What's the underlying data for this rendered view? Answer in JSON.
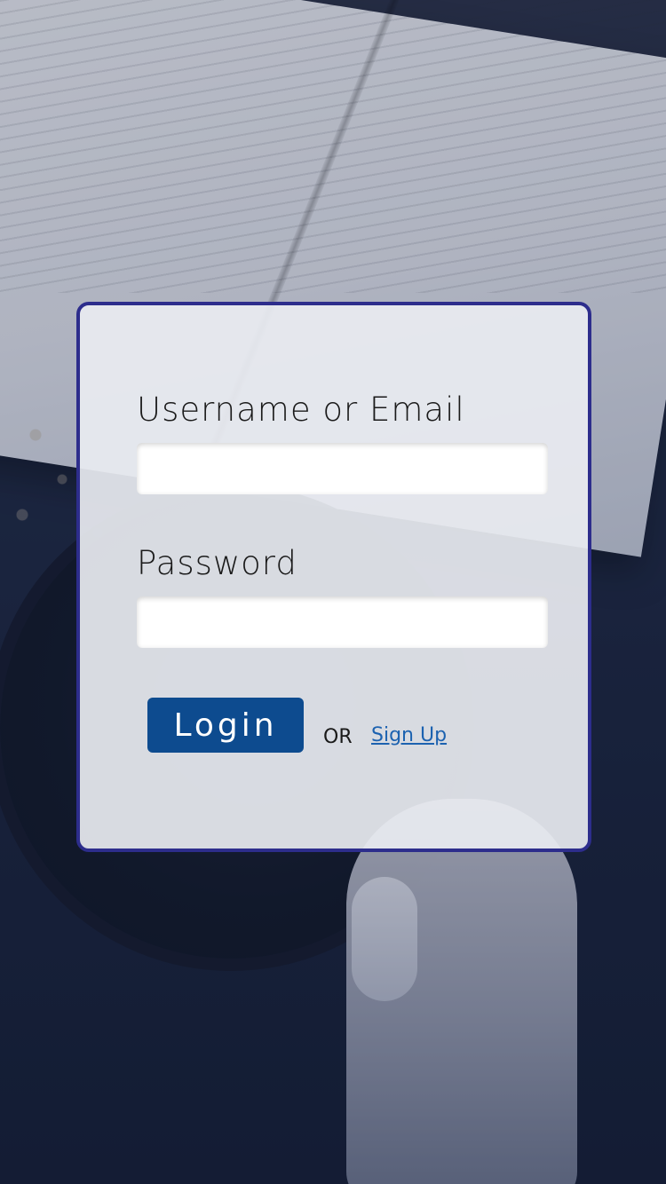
{
  "login_card": {
    "username_label": "Username or Email",
    "username_value": "",
    "password_label": "Password",
    "password_value": "",
    "login_button_label": "Login",
    "or_text": "OR",
    "signup_link_label": "Sign Up"
  },
  "colors": {
    "card_border": "#2d2d8c",
    "login_button": "#0d4b8f",
    "signup_link": "#1c62b0"
  }
}
